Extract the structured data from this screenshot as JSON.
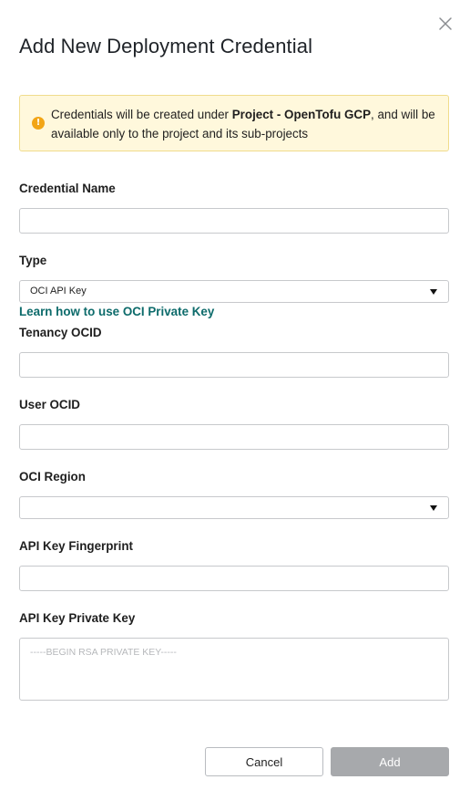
{
  "dialog": {
    "title": "Add New Deployment Credential"
  },
  "alert": {
    "text_before": "Credentials will be created under ",
    "project_name": "Project - OpenTofu GCP",
    "text_after": ", and will be available only to the project and its sub-projects",
    "icon_glyph": "!"
  },
  "fields": {
    "credential_name": {
      "label": "Credential Name",
      "value": ""
    },
    "type": {
      "label": "Type",
      "selected": "OCI API Key"
    },
    "learn_link": "Learn how to use OCI Private Key",
    "tenancy_ocid": {
      "label": "Tenancy OCID",
      "value": ""
    },
    "user_ocid": {
      "label": "User OCID",
      "value": ""
    },
    "oci_region": {
      "label": "OCI Region",
      "selected": ""
    },
    "fingerprint": {
      "label": "API Key Fingerprint",
      "value": ""
    },
    "private_key": {
      "label": "API Key Private Key",
      "placeholder": "-----BEGIN RSA PRIVATE KEY-----"
    }
  },
  "actions": {
    "cancel_label": "Cancel",
    "add_label": "Add"
  },
  "colors": {
    "alert_bg": "#fff8dc",
    "alert_icon": "#f2a516",
    "link": "#0d6b6b",
    "add_disabled": "#a7a9ac"
  }
}
